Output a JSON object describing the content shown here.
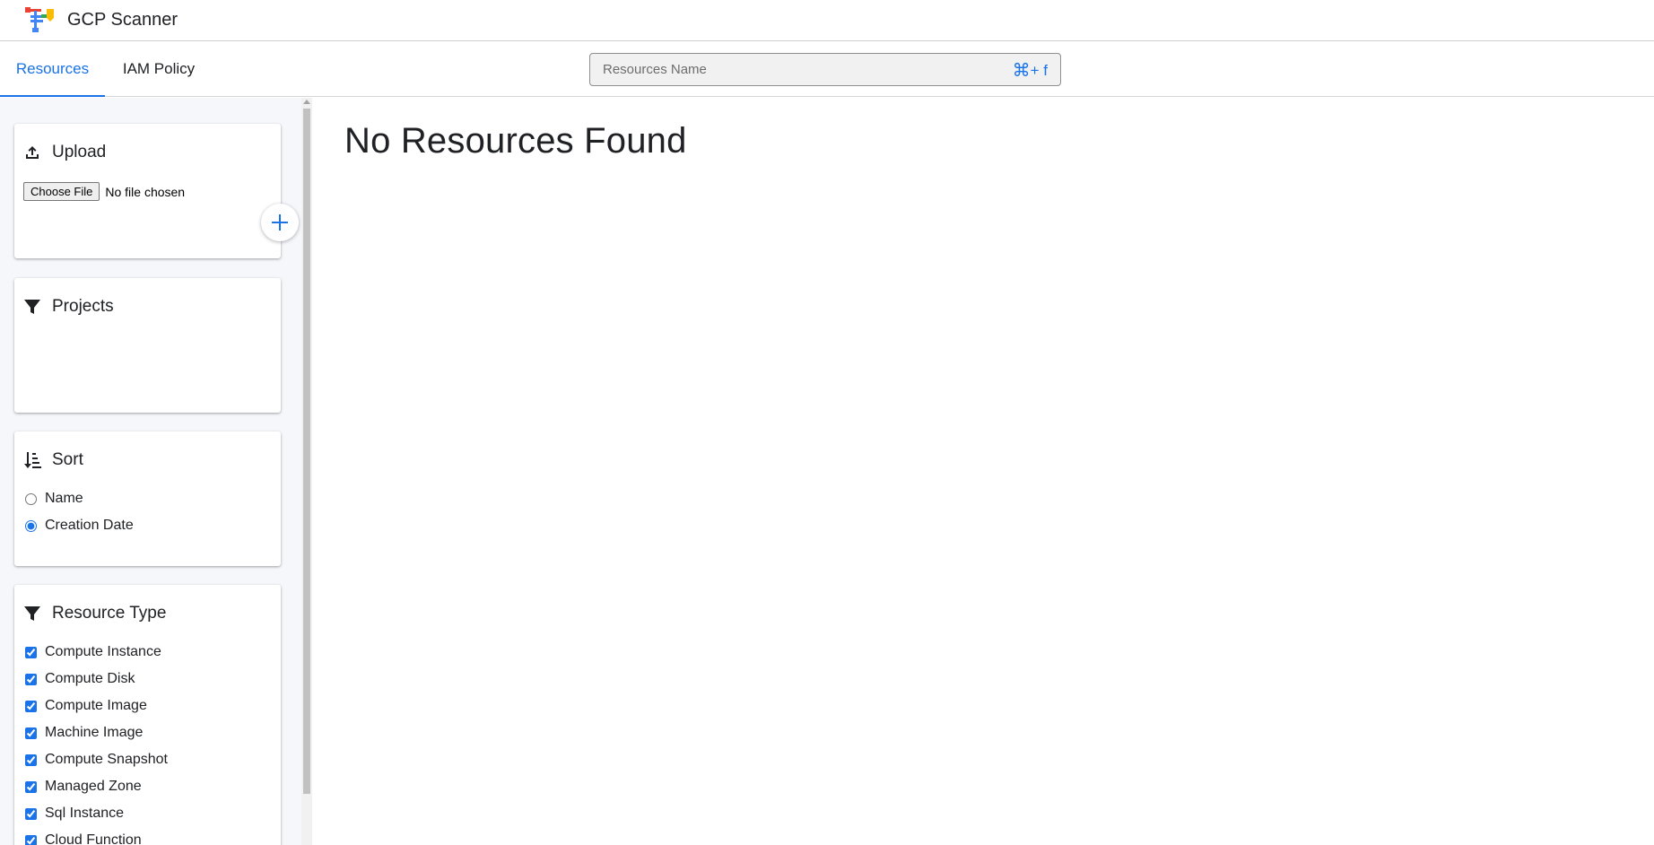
{
  "header": {
    "app_title": "GCP Scanner",
    "logo_icon": "gcp-scanner-logo"
  },
  "tabs": [
    {
      "label": "Resources",
      "active": true
    },
    {
      "label": "IAM Policy",
      "active": false
    }
  ],
  "search": {
    "placeholder": "Resources Name",
    "value": "",
    "shortcut_icon": "command-key-icon",
    "shortcut_text": "+ f"
  },
  "sidebar": {
    "upload": {
      "title": "Upload",
      "icon": "upload-icon",
      "file_button_label": "Choose File",
      "file_status": "No file chosen"
    },
    "projects": {
      "title": "Projects",
      "icon": "filter-icon"
    },
    "sort": {
      "title": "Sort",
      "icon": "sort-icon",
      "options": [
        {
          "label": "Name",
          "checked": false
        },
        {
          "label": "Creation Date",
          "checked": true
        }
      ]
    },
    "resource_type": {
      "title": "Resource Type",
      "icon": "filter-icon",
      "options": [
        {
          "label": "Compute Instance",
          "checked": true
        },
        {
          "label": "Compute Disk",
          "checked": true
        },
        {
          "label": "Compute Image",
          "checked": true
        },
        {
          "label": "Machine Image",
          "checked": true
        },
        {
          "label": "Compute Snapshot",
          "checked": true
        },
        {
          "label": "Managed Zone",
          "checked": true
        },
        {
          "label": "Sql Instance",
          "checked": true
        },
        {
          "label": "Cloud Function",
          "checked": true
        }
      ]
    },
    "add_button_icon": "plus-icon"
  },
  "main": {
    "empty_message": "No Resources Found"
  },
  "colors": {
    "accent": "#1a73e8",
    "sidebar_bg": "#f6f7fb"
  }
}
